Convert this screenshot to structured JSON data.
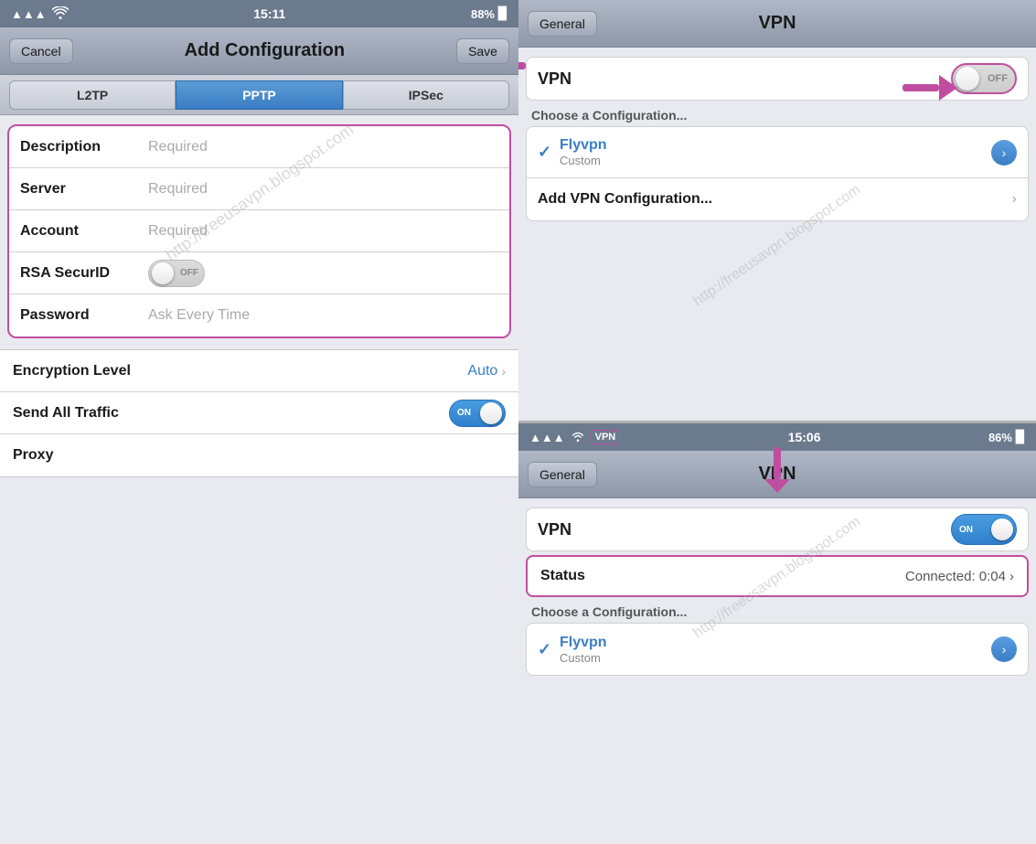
{
  "left": {
    "statusBar": {
      "signal": "●●●",
      "wifi": "WiFi",
      "time": "15:11",
      "battery": "88%"
    },
    "navBar": {
      "cancelLabel": "Cancel",
      "title": "Add Configuration",
      "saveLabel": "Save"
    },
    "tabs": [
      {
        "label": "L2TP",
        "active": false
      },
      {
        "label": "PPTP",
        "active": true
      },
      {
        "label": "IPSec",
        "active": false
      }
    ],
    "formFields": [
      {
        "label": "Description",
        "placeholder": "Required"
      },
      {
        "label": "Server",
        "placeholder": "Required"
      },
      {
        "label": "Account",
        "placeholder": "Required"
      },
      {
        "label": "RSA SecurID",
        "type": "toggle",
        "value": "OFF"
      },
      {
        "label": "Password",
        "placeholder": "Ask Every Time"
      }
    ],
    "bottomRows": [
      {
        "label": "Encryption Level",
        "value": "Auto",
        "hasChevron": true
      },
      {
        "label": "Send All Traffic",
        "type": "toggle",
        "value": "ON"
      },
      {
        "label": "Proxy",
        "value": ""
      }
    ],
    "watermark": "http://freeusavpn.blogspot.com"
  },
  "right": {
    "top": {
      "navBar": {
        "generalLabel": "General",
        "title": "VPN"
      },
      "vpnRow": {
        "label": "VPN",
        "toggleValue": "OFF"
      },
      "chooseConfigLabel": "Choose a Configuration...",
      "configs": [
        {
          "checked": true,
          "name": "Flyvpn",
          "type": "Custom",
          "hasArrow": true
        }
      ],
      "addConfig": {
        "label": "Add VPN Configuration...",
        "hasChevron": true
      }
    },
    "bottom": {
      "statusBar": {
        "signal": "●●●",
        "wifi": "WiFi",
        "vpnBadge": "VPN",
        "time": "15:06",
        "battery": "86%"
      },
      "navBar": {
        "generalLabel": "General",
        "title": "VPN"
      },
      "vpnRow": {
        "label": "VPN",
        "toggleValue": "ON"
      },
      "statusRow": {
        "label": "Status",
        "value": "Connected: 0:04"
      },
      "chooseConfigLabel": "Choose a Configuration...",
      "configs": [
        {
          "checked": true,
          "name": "Flyvpn",
          "type": "Custom",
          "hasArrow": true
        }
      ],
      "watermark": "http://freeusavpn.blogspot.com"
    }
  }
}
